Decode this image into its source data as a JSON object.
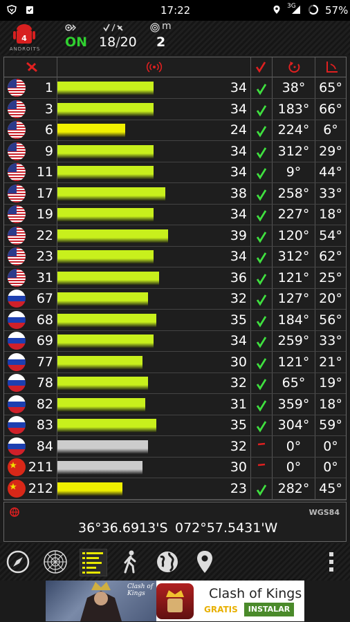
{
  "status_bar": {
    "time": "17:22",
    "network": "3G",
    "battery": "57%"
  },
  "header": {
    "app_logo_text": "ANDROITS",
    "fix_status": "ON",
    "satellites_used": "18",
    "satellites_total": "20",
    "sep": "/",
    "accuracy_unit": "m",
    "accuracy_value": "2"
  },
  "satellites": [
    {
      "country": "us",
      "prn": "1",
      "snr": 34,
      "used": true,
      "azimuth": "38°",
      "elevation": "65°"
    },
    {
      "country": "us",
      "prn": "3",
      "snr": 34,
      "used": true,
      "azimuth": "183°",
      "elevation": "66°"
    },
    {
      "country": "us",
      "prn": "6",
      "snr": 24,
      "used": true,
      "azimuth": "224°",
      "elevation": "6°"
    },
    {
      "country": "us",
      "prn": "9",
      "snr": 34,
      "used": true,
      "azimuth": "312°",
      "elevation": "29°"
    },
    {
      "country": "us",
      "prn": "11",
      "snr": 34,
      "used": true,
      "azimuth": "9°",
      "elevation": "44°"
    },
    {
      "country": "us",
      "prn": "17",
      "snr": 38,
      "used": true,
      "azimuth": "258°",
      "elevation": "33°"
    },
    {
      "country": "us",
      "prn": "19",
      "snr": 34,
      "used": true,
      "azimuth": "227°",
      "elevation": "18°"
    },
    {
      "country": "us",
      "prn": "22",
      "snr": 39,
      "used": true,
      "azimuth": "120°",
      "elevation": "54°"
    },
    {
      "country": "us",
      "prn": "23",
      "snr": 34,
      "used": true,
      "azimuth": "312°",
      "elevation": "62°"
    },
    {
      "country": "us",
      "prn": "31",
      "snr": 36,
      "used": true,
      "azimuth": "121°",
      "elevation": "25°"
    },
    {
      "country": "ru",
      "prn": "67",
      "snr": 32,
      "used": true,
      "azimuth": "127°",
      "elevation": "20°"
    },
    {
      "country": "ru",
      "prn": "68",
      "snr": 35,
      "used": true,
      "azimuth": "184°",
      "elevation": "56°"
    },
    {
      "country": "ru",
      "prn": "69",
      "snr": 34,
      "used": true,
      "azimuth": "259°",
      "elevation": "33°"
    },
    {
      "country": "ru",
      "prn": "77",
      "snr": 30,
      "used": true,
      "azimuth": "121°",
      "elevation": "21°"
    },
    {
      "country": "ru",
      "prn": "78",
      "snr": 32,
      "used": true,
      "azimuth": "65°",
      "elevation": "19°"
    },
    {
      "country": "ru",
      "prn": "82",
      "snr": 31,
      "used": true,
      "azimuth": "359°",
      "elevation": "18°"
    },
    {
      "country": "ru",
      "prn": "83",
      "snr": 35,
      "used": true,
      "azimuth": "304°",
      "elevation": "59°"
    },
    {
      "country": "ru",
      "prn": "84",
      "snr": 32,
      "used": false,
      "azimuth": "0°",
      "elevation": "0°"
    },
    {
      "country": "cn",
      "prn": "211",
      "snr": 30,
      "used": false,
      "azimuth": "0°",
      "elevation": "0°"
    },
    {
      "country": "cn",
      "prn": "212",
      "snr": 23,
      "used": true,
      "azimuth": "282°",
      "elevation": "45°"
    }
  ],
  "coords": {
    "datum": "WGS84",
    "latitude": "36°36.6913'S",
    "longitude": "072°57.5431'W"
  },
  "ad": {
    "title": "Clash of Kings",
    "free": "GRATIS",
    "install": "INSTALAR",
    "banner_text": "Clash of Kings"
  },
  "colors": {
    "bar_green": "#c8f01c",
    "bar_yellow": "#f0f000",
    "bar_gray": "#cccccc",
    "accent_red": "#e02020",
    "check_green": "#3fe03f",
    "fix_on": "#30d030"
  }
}
